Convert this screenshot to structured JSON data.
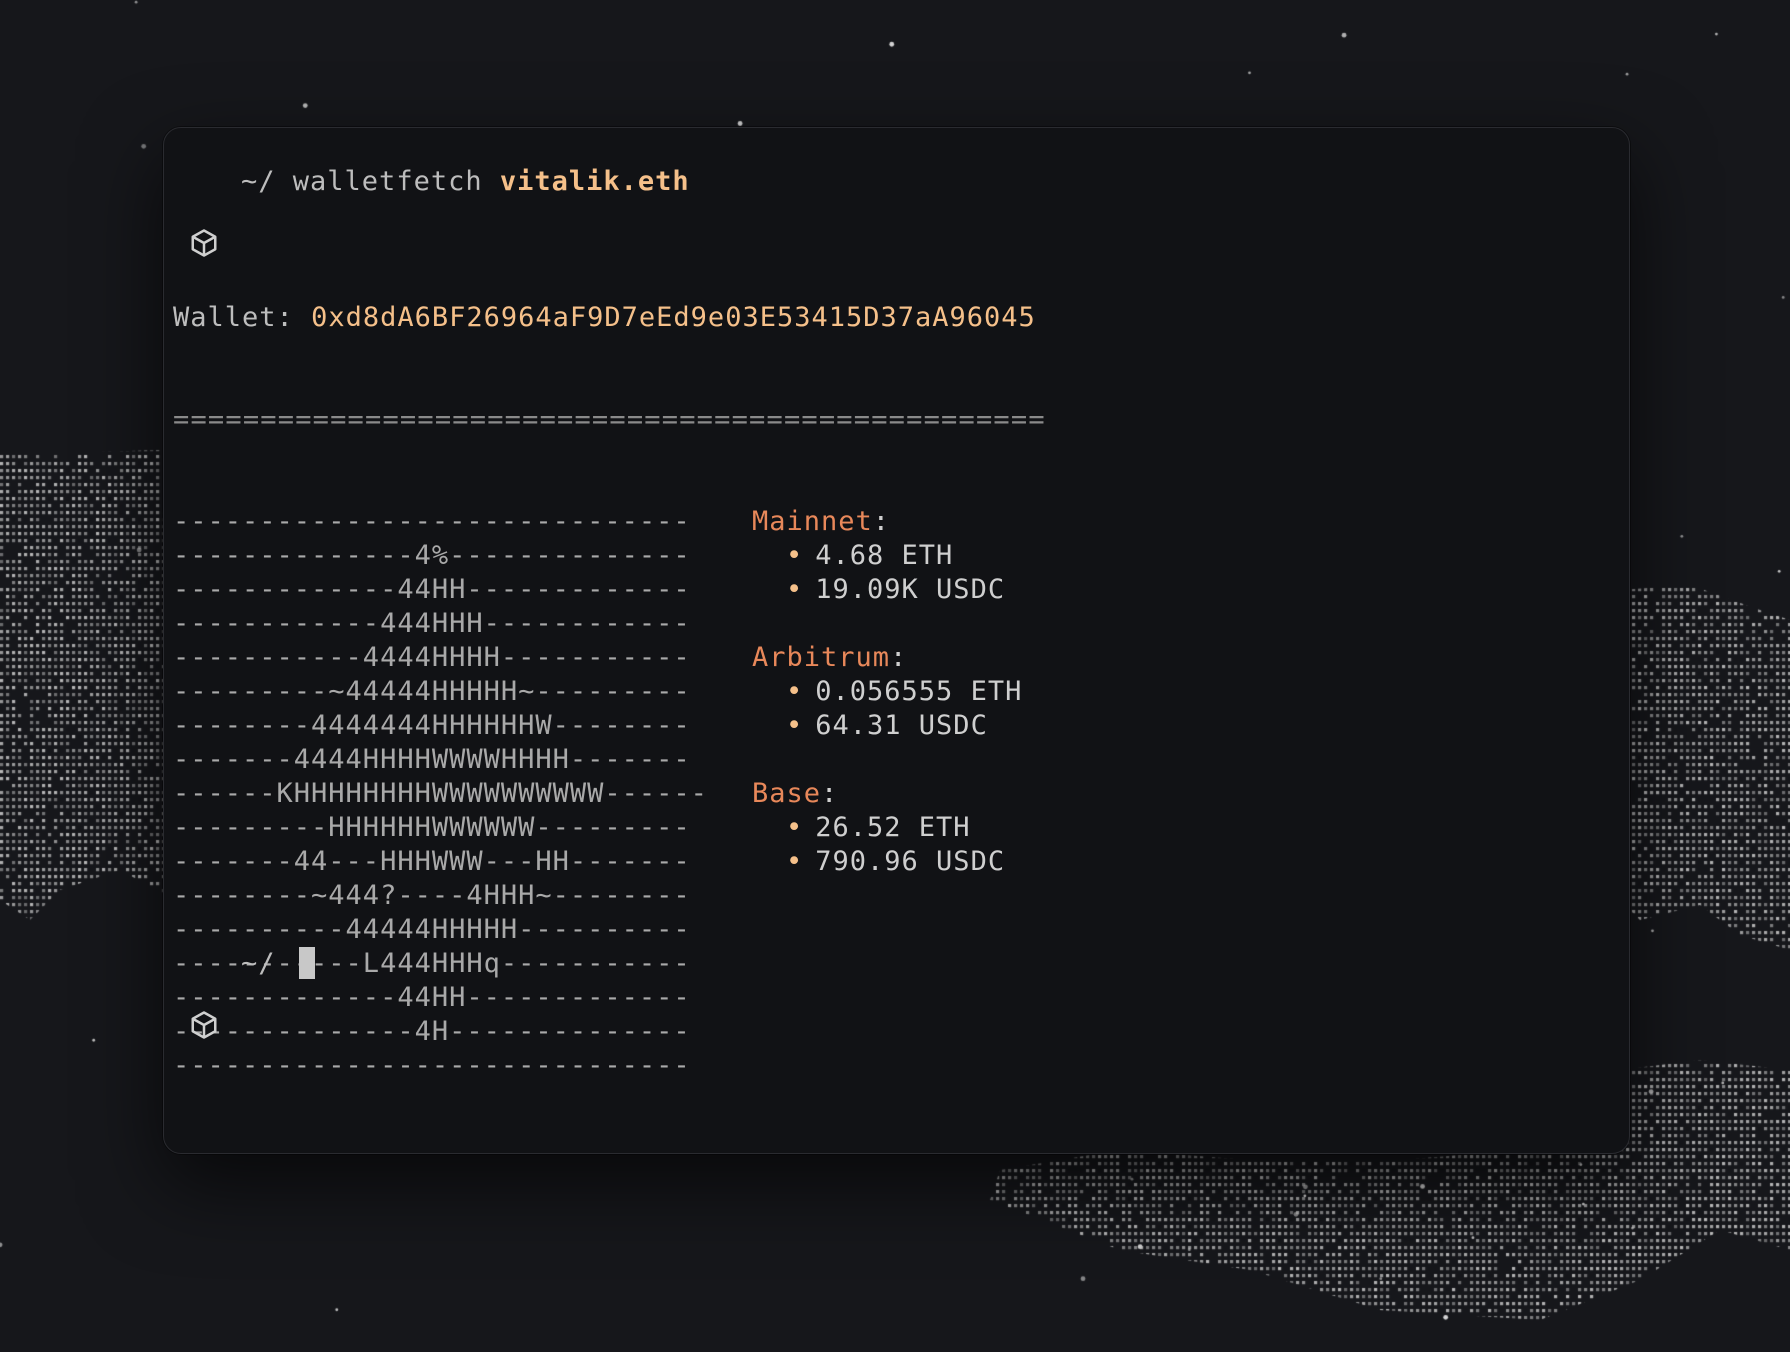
{
  "prompt": {
    "path": "~/",
    "command": "walletfetch",
    "argument": "vitalik.eth",
    "icon": "cube-icon"
  },
  "wallet": {
    "label": "Wallet:",
    "address": "0xd8dA6BF26964aF9D7eEd9e03E53415D37aA96045"
  },
  "rule": "==================================================",
  "ascii_art": [
    "------------------------------",
    "--------------4%--------------",
    "-------------44HH-------------",
    "------------444HHH------------",
    "-----------4444HHHH-----------",
    "---------~44444HHHHH~---------",
    "--------4444444HHHHHHW--------",
    "-------4444HHHHWWWWHHHH-------",
    "------KHHHHHHHHWWWWWWWWWW------",
    "---------HHHHHHWWWWWW---------",
    "-------44---HHHWWW---HH-------",
    "--------~444?----4HHH~--------",
    "----------44444HHHHH----------",
    "-----------L444HHHq-----------",
    "-------------44HH-------------",
    "--------------4H--------------",
    "------------------------------"
  ],
  "networks": [
    {
      "name": "Mainnet",
      "assets": [
        "4.68 ETH",
        "19.09K USDC"
      ]
    },
    {
      "name": "Arbitrum",
      "assets": [
        "0.056555 ETH",
        "64.31 USDC"
      ]
    },
    {
      "name": "Base",
      "assets": [
        "26.52 ETH",
        "790.96 USDC"
      ]
    }
  ],
  "second_prompt": {
    "path": "~/"
  },
  "colors": {
    "background": "#16171b",
    "terminal": "#111215",
    "accent_argument": "#f5c08a",
    "network_name": "#e8885a"
  }
}
